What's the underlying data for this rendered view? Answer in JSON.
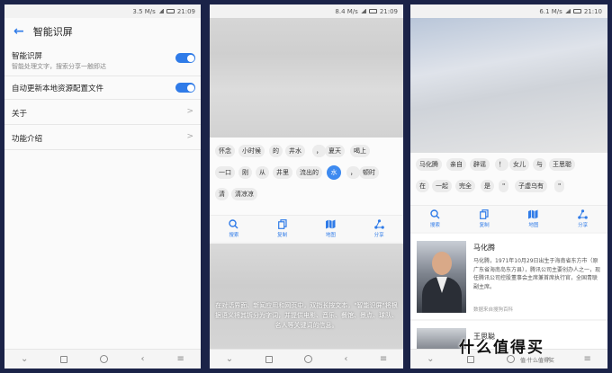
{
  "panel1": {
    "status": {
      "speed": "3.5 M/s",
      "time": "21:09"
    },
    "title": "智能识屏",
    "settings": [
      {
        "label": "智能识屏",
        "sub": "智能处理文字，搜索分享一触即达",
        "toggle": true
      },
      {
        "label": "自动更新本地资源配置文件",
        "sub": "",
        "toggle": true
      },
      {
        "label": "关于",
        "sub": "",
        "toggle": false
      },
      {
        "label": "功能介绍",
        "sub": "",
        "toggle": false
      }
    ]
  },
  "panel2": {
    "status": {
      "speed": "8.4 M/s",
      "time": "21:09"
    },
    "tokens_row1": [
      "怀念",
      "小时候",
      "的",
      "井水",
      "，",
      "夏天",
      "喝上"
    ],
    "tokens_row2": [
      "一口",
      "刚",
      "从",
      "井里",
      "流出的",
      "水",
      "，",
      "顿时"
    ],
    "tokens_row3": [
      "清",
      "清凉凉"
    ],
    "selected_token": "水",
    "tools": [
      "搜索",
      "复制",
      "地图",
      "分享"
    ],
    "caption": "在对话界面、新闻应用和网页中，双指长按文本，\"智能识屏\"将根据语义将其拆分为字词，并提供电影、音乐、餐馆、景点、球队、名人等关键词的信息。"
  },
  "panel3": {
    "status": {
      "speed": "6.1 M/s",
      "time": "21:10"
    },
    "tokens_row1": [
      "马化腾",
      "亲自",
      "辟谣",
      "！",
      "女儿",
      "与",
      "王思聪"
    ],
    "tokens_row2": [
      "在",
      "一起",
      "完全",
      "是",
      "\"",
      "子虚乌有",
      "\""
    ],
    "tools": [
      "搜索",
      "复制",
      "地图",
      "分享"
    ],
    "card": {
      "name": "马化腾",
      "desc": "马化腾，1971年10月29日出生于海南省东方市（原广东省海南岛东方县），腾讯公司主要创办人之一，现任腾讯公司控股董事会主席兼首席执行官，全国青联副主席。",
      "source": "数据来自搜狗百科"
    },
    "card2_name": "王思聪"
  },
  "watermark": {
    "text": "什么值得买",
    "sub": "值·什么值得买"
  },
  "colors": {
    "accent": "#2f7be8",
    "background": "#1b2348"
  }
}
